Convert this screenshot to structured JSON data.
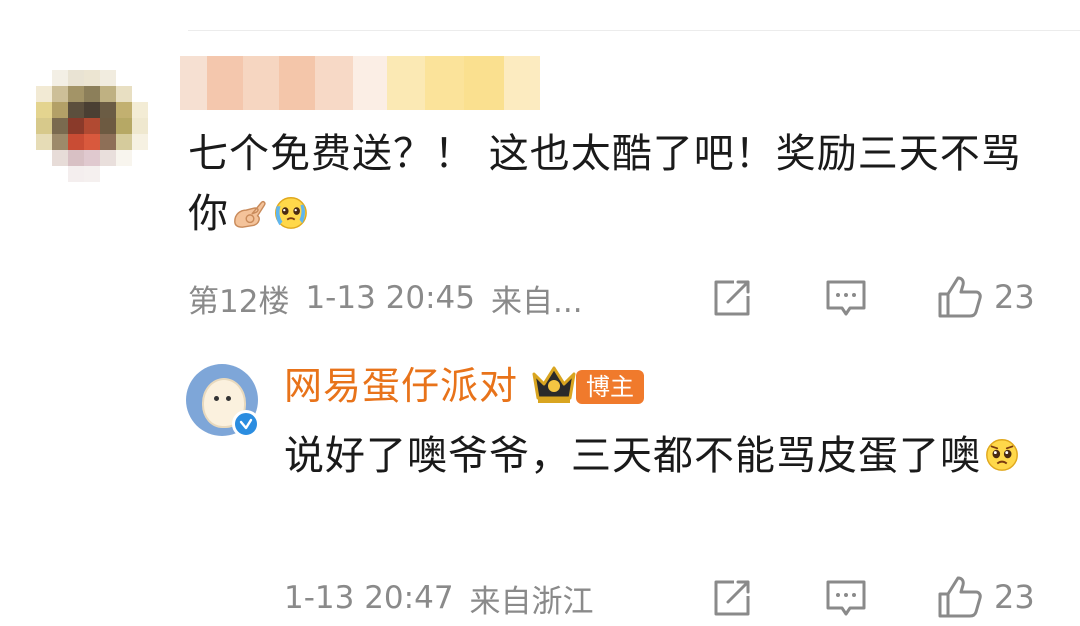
{
  "comment": {
    "text": "七个免费送？！ 这也太酷了吧！奖励三天不骂你",
    "floor": "第12楼",
    "time": "1-13 20:45",
    "source": "来自...",
    "like_count": "23",
    "emojis": [
      "ok-hand-emoji",
      "crying-face-emoji"
    ]
  },
  "reply": {
    "author": "网易蛋仔派对",
    "badge": "博主",
    "text": "说好了噢爷爷，三天都不能骂皮蛋了噢",
    "time": "1-13 20:47",
    "source": "来自浙江",
    "like_count": "23",
    "emojis": [
      "pleading-face-emoji"
    ]
  },
  "colors": {
    "accent_name": "#e8731a",
    "badge_bg": "#f07a2c",
    "verify_blue": "#2b8de0",
    "meta_gray": "#8a8a8a"
  }
}
